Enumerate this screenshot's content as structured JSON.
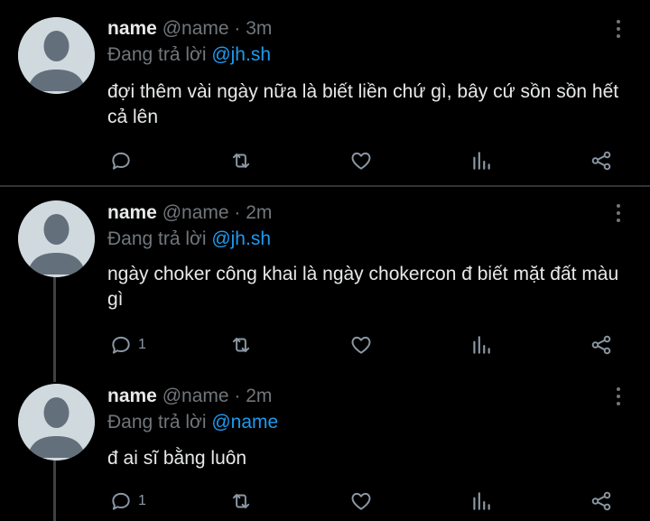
{
  "colors": {
    "background": "#000000",
    "text": "#e7e9ea",
    "muted": "#71767b",
    "mention": "#1d9bf0",
    "avatar": "#cfd9de"
  },
  "tweets": [
    {
      "name": "name",
      "handle": "@name",
      "separator": "·",
      "time": "3m",
      "reply_prefix": "Đang trả lời",
      "reply_to": "@jh.sh",
      "text": "đợi thêm vài ngày nữa là biết liền chứ gì, bây cứ sồn sồn hết cả lên",
      "reply_count": ""
    },
    {
      "name": "name",
      "handle": "@name",
      "separator": "·",
      "time": "2m",
      "reply_prefix": "Đang trả lời",
      "reply_to": "@jh.sh",
      "text": "ngày choker công khai là ngày chokercon đ biết mặt đất màu gì",
      "reply_count": "1"
    },
    {
      "name": "name",
      "handle": "@name",
      "separator": "·",
      "time": "2m",
      "reply_prefix": "Đang trả lời",
      "reply_to": "@name",
      "text": "đ ai sĩ bằng luôn",
      "reply_count": "1"
    }
  ],
  "icons": {
    "reply": "reply-icon",
    "retweet": "retweet-icon",
    "like": "heart-icon",
    "views": "views-chart-icon",
    "share": "share-icon",
    "more": "more-dots-icon"
  }
}
